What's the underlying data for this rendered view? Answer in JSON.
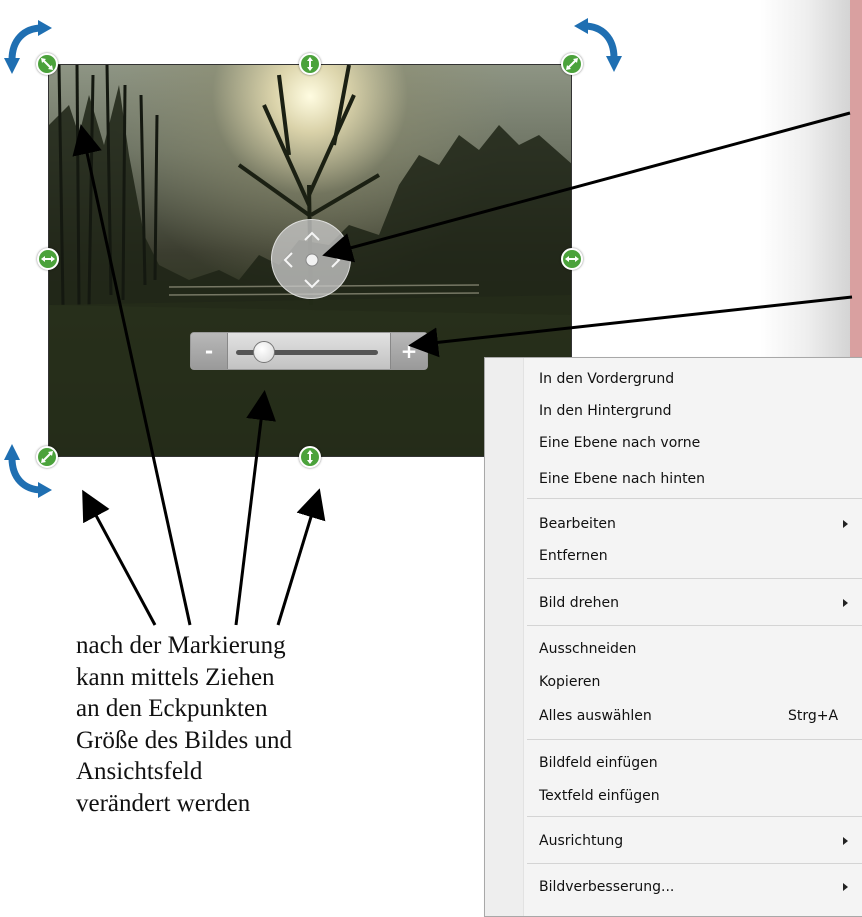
{
  "zoom": {
    "minus_label": "-",
    "plus_label": "+",
    "level": 0.2
  },
  "caption": {
    "lines": [
      "nach der Markierung",
      "kann mittels Ziehen",
      "an den Eckpunkten",
      "Größe des Bildes und",
      "Ansichtsfeld",
      "verändert werden"
    ]
  },
  "context_menu": {
    "items": [
      {
        "label": "In den Vordergrund"
      },
      {
        "label": "In den Hintergrund"
      },
      {
        "label": "Eine Ebene nach vorne"
      },
      {
        "label": "Eine Ebene nach hinten"
      },
      {
        "label": "Bearbeiten",
        "submenu": true
      },
      {
        "label": "Entfernen"
      },
      {
        "label": "Bild drehen",
        "submenu": true
      },
      {
        "label": "Ausschneiden"
      },
      {
        "label": "Kopieren"
      },
      {
        "label": "Alles auswählen",
        "shortcut": "Strg+A"
      },
      {
        "label": "Bildfeld einfügen"
      },
      {
        "label": "Textfeld einfügen"
      },
      {
        "label": "Ausrichtung",
        "submenu": true
      },
      {
        "label": "Bildverbesserung...",
        "submenu": true
      }
    ]
  },
  "colors": {
    "handle": "#4ba23b",
    "rotate_arrow": "#1f6fb2",
    "annotation_arrow": "#000000",
    "side_strip": "#d9a0a0"
  },
  "icons": {
    "corner_handle": "diagonal-resize-icon",
    "edge_handle_vertical": "vertical-resize-icon",
    "edge_handle_horizontal": "horizontal-resize-icon",
    "rotate": "rotate-arrow-icon",
    "pan": "pan-control-icon",
    "submenu": "submenu-arrow-icon"
  }
}
